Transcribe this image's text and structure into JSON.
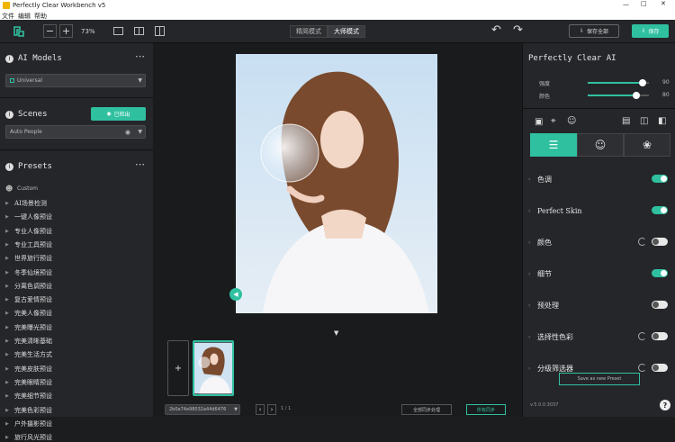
{
  "window": {
    "title": "Perfectly Clear Workbench v5",
    "menu": [
      "文件",
      "编辑",
      "帮助"
    ]
  },
  "toolbar": {
    "zoom": "73%",
    "mode_left": "精简模式",
    "mode_right": "大师模式",
    "save_all": "保存全部",
    "save": "保存"
  },
  "left": {
    "ai_models_title": "AI Models",
    "ai_model_value": "Universal",
    "scenes_title": "Scenes",
    "scenes_button": "已检出",
    "scene_value": "Auto People",
    "presets_title": "Presets",
    "custom_label": "Custom",
    "presets": [
      "AI场景检测",
      "一键人像预设",
      "专业人像预设",
      "专业工具预设",
      "世界旅行预设",
      "冬季仙境预设",
      "分离色调预设",
      "复古爱情预设",
      "完美人像预设",
      "完美曝光预设",
      "完美清晰基础",
      "完美生活方式",
      "完美皮肤预设",
      "完美眼睛预设",
      "完美细节预设",
      "完美色彩预设",
      "户外摄影预设",
      "旅行风光预设"
    ]
  },
  "center": {
    "file_name": "2b0a74e98032a44d6476",
    "page_info": "1 / 1",
    "sync_all": "全部同步处理",
    "sync_selected": "所有同步",
    "add_symbol": "+"
  },
  "right": {
    "title": "Perfectly Clear AI",
    "sliders": [
      {
        "label": "强度",
        "value": "90",
        "level": 0.9
      },
      {
        "label": "颜色",
        "value": "80",
        "level": 0.8
      }
    ],
    "adjustments": [
      {
        "label": "色调",
        "state": "on",
        "reset": false
      },
      {
        "label": "Perfect Skin",
        "state": "on",
        "reset": false
      },
      {
        "label": "颜色",
        "state": "off",
        "reset": true
      },
      {
        "label": "细节",
        "state": "on",
        "reset": false
      },
      {
        "label": "预处理",
        "state": "off",
        "reset": false
      },
      {
        "label": "选择性色彩",
        "state": "off",
        "reset": true
      },
      {
        "label": "分级筛选器",
        "state": "off",
        "reset": true
      }
    ],
    "save_preset": "Save as new Preset",
    "version": "v:5.0.0.3037",
    "help": "?"
  },
  "colors": {
    "accent": "#2fc0a0",
    "panel": "#25262a",
    "canvas": "#1a1b1d"
  }
}
